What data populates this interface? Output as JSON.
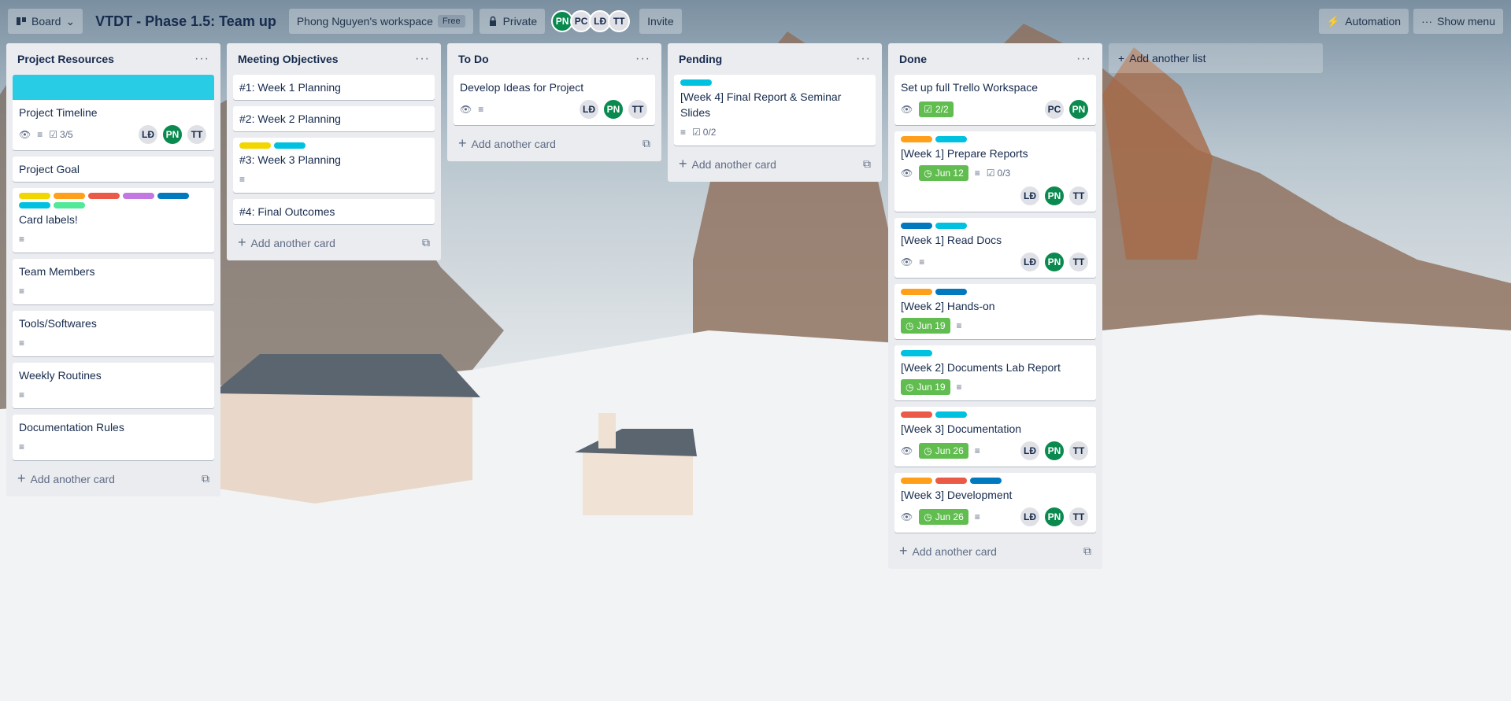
{
  "header": {
    "view_switcher": "Board",
    "board_title": "VTDT - Phase 1.5: Team up",
    "workspace": "Phong Nguyen's workspace",
    "workspace_badge": "Free",
    "visibility": "Private",
    "members": [
      "PN",
      "PC",
      "LĐ",
      "TT"
    ],
    "invite": "Invite",
    "automation": "Automation",
    "show_menu": "Show menu"
  },
  "add_another_list": "Add another list",
  "add_card_label": "Add another card",
  "colors": {
    "green": "#61bd4f",
    "yellow": "#f2d600",
    "orange": "#ff9f1a",
    "red": "#eb5a46",
    "purple": "#c377e0",
    "blue": "#0079bf",
    "sky": "#00c2e0",
    "lime": "#51e898",
    "pn_avatar": "#0a8a4f"
  },
  "lists": [
    {
      "title": "Project Resources",
      "cards": [
        {
          "title": "Project Timeline",
          "checklist": "3/5",
          "members": [
            "LĐ",
            "PN",
            "TT"
          ]
        },
        {
          "title": "Project Goal"
        },
        {
          "title": "Card labels!"
        },
        {
          "title": "Team Members"
        },
        {
          "title": "Tools/Softwares"
        },
        {
          "title": "Weekly Routines"
        },
        {
          "title": "Documentation Rules"
        }
      ]
    },
    {
      "title": "Meeting Objectives",
      "cards": [
        {
          "title": "#1: Week 1 Planning"
        },
        {
          "title": "#2: Week 2 Planning"
        },
        {
          "title": "#3: Week 3 Planning"
        },
        {
          "title": "#4: Final Outcomes"
        }
      ]
    },
    {
      "title": "To Do",
      "cards": [
        {
          "title": "Develop Ideas for Project",
          "members": [
            "LĐ",
            "PN",
            "TT"
          ]
        }
      ]
    },
    {
      "title": "Pending",
      "cards": [
        {
          "title": "[Week 4] Final Report & Seminar Slides",
          "checklist": "0/2"
        }
      ]
    },
    {
      "title": "Done",
      "cards": [
        {
          "title": "Set up full Trello Workspace",
          "checklist": "2/2",
          "members": [
            "PC",
            "PN"
          ]
        },
        {
          "title": "[Week 1] Prepare Reports",
          "due": "Jun 12",
          "checklist": "0/3",
          "members": [
            "LĐ",
            "PN",
            "TT"
          ]
        },
        {
          "title": "[Week 1] Read Docs",
          "members": [
            "LĐ",
            "PN",
            "TT"
          ]
        },
        {
          "title": "[Week 2] Hands-on",
          "due": "Jun 19"
        },
        {
          "title": "[Week 2] Documents Lab Report",
          "due": "Jun 19"
        },
        {
          "title": "[Week 3] Documentation",
          "due": "Jun 26",
          "members": [
            "LĐ",
            "PN",
            "TT"
          ]
        },
        {
          "title": "[Week 3] Development",
          "due": "Jun 26",
          "members": [
            "LĐ",
            "PN",
            "TT"
          ]
        }
      ]
    }
  ]
}
